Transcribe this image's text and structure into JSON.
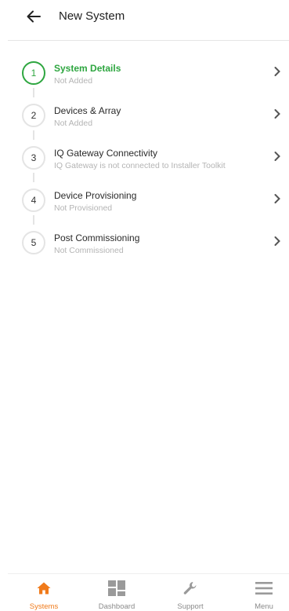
{
  "header": {
    "title": "New System",
    "back_icon": "arrow-left-icon"
  },
  "steps": [
    {
      "number": "1",
      "title": "System Details",
      "subtitle": "Not Added",
      "active": true
    },
    {
      "number": "2",
      "title": "Devices & Array",
      "subtitle": "Not Added",
      "active": false
    },
    {
      "number": "3",
      "title": "IQ Gateway Connectivity",
      "subtitle": "IQ Gateway is not connected to Installer Toolkit",
      "active": false
    },
    {
      "number": "4",
      "title": "Device Provisioning",
      "subtitle": "Not Provisioned",
      "active": false
    },
    {
      "number": "5",
      "title": "Post Commissioning",
      "subtitle": "Not Commissioned",
      "active": false
    }
  ],
  "bottom_nav": [
    {
      "label": "Systems",
      "icon": "home-icon",
      "active": true
    },
    {
      "label": "Dashboard",
      "icon": "dashboard-icon",
      "active": false
    },
    {
      "label": "Support",
      "icon": "wrench-icon",
      "active": false
    },
    {
      "label": "Menu",
      "icon": "menu-icon",
      "active": false
    }
  ],
  "colors": {
    "active_green": "#2ea640",
    "active_orange": "#f07a1a",
    "inactive_gray": "#8a8a8a"
  }
}
